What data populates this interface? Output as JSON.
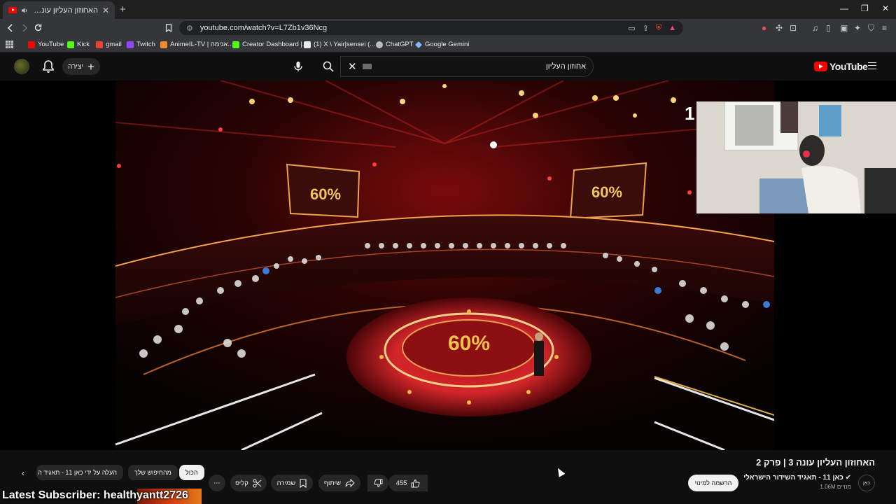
{
  "browser": {
    "tab_title": "האחוזון העליון עונה 3 | פרק 2",
    "tab_close": "✕",
    "new_tab": "+",
    "url": "youtube.com/watch?v=L7Zb1v36Ncg",
    "window_controls": [
      "—",
      "❐",
      "✕"
    ],
    "bookmarks": [
      {
        "label": "YouTube",
        "color": "#ff0000"
      },
      {
        "label": "Kick",
        "color": "#53fc18"
      },
      {
        "label": "gmail",
        "color": "#ea4335"
      },
      {
        "label": "Twitch",
        "color": "#9146ff"
      },
      {
        "label": "AnimeIL-TV | אנימה...",
        "color": "#f28b30"
      },
      {
        "label": "Creator Dashboard |...",
        "color": "#53fc18"
      },
      {
        "label": "(1) X \\ Yair|sensei (...",
        "color": "#e8eaed"
      },
      {
        "label": "ChatGPT",
        "color": "#bdbdbd"
      },
      {
        "label": "Google Gemini",
        "color": "#8ab4f8"
      }
    ]
  },
  "youtube_header": {
    "create_label": "יצירה",
    "search_query": "אחוזון העליון",
    "logo_text": "YouTube"
  },
  "player": {
    "timecode_fragment": "1",
    "screen_percent": "60%",
    "floor_percent": "60%"
  },
  "video": {
    "title": "האחוזון העליון עונה 3 | פרק 2",
    "channel_name": "כאן 11 - תאגיד השידור הישראלי",
    "channel_subs": "1.06M מנויים",
    "channel_avatar_text": "כאן",
    "subscribe_label": "הרשמה למינוי",
    "likes": "455",
    "share_label": "שיתוף",
    "save_label": "שמירה",
    "clip_label": "קליפ",
    "more": "⋯"
  },
  "chips": {
    "all": "הכול",
    "from_search": "מהחיפוש שלך",
    "uploaded_by": "העלה על ידי כאן 11 - תאגיד ה"
  },
  "overlay": {
    "latest_subscriber": "Latest Subscriber: healthyantt2726"
  }
}
